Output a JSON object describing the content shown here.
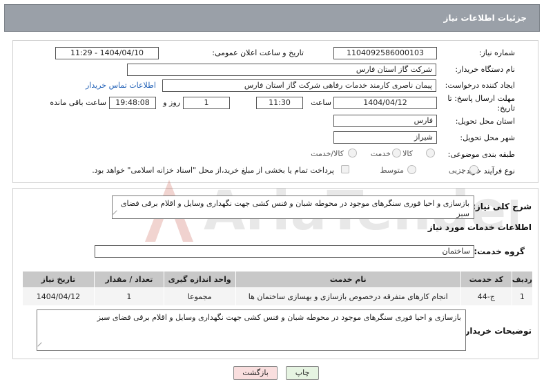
{
  "header": {
    "title": "جزئیات اطلاعات نیاز"
  },
  "form": {
    "need_number_label": "شماره نیاز:",
    "need_number": "1104092586000103",
    "announce_label": "تاریخ و ساعت اعلان عمومی:",
    "announce_value": "1404/04/10 - 11:29",
    "buyer_org_label": "نام دستگاه خریدار:",
    "buyer_org": "شرکت گاز استان فارس",
    "requester_label": "ایجاد کننده درخواست:",
    "requester": "پیمان ناصری کارمند خدمات رفاهی شرکت گاز استان فارس",
    "contact_link": "اطلاعات تماس خریدار",
    "deadline_label": "مهلت ارسال پاسخ: تا تاریخ:",
    "deadline_date": "1404/04/12",
    "time_label": "ساعت",
    "deadline_time": "11:30",
    "days_value": "1",
    "days_label": "روز و",
    "remaining_time": "19:48:08",
    "remaining_label": "ساعت باقی مانده",
    "province_label": "استان محل تحویل:",
    "province": "فارس",
    "city_label": "شهر محل تحویل:",
    "city": "شیراز",
    "category_label": "طبقه بندی موضوعی:",
    "category_options": [
      "کالا",
      "خدمت",
      "کالا/خدمت"
    ],
    "process_label": "نوع فرآیند خرید :",
    "process_options": [
      "جزیی",
      "متوسط"
    ],
    "payment_note": "پرداخت تمام یا بخشی از مبلغ خرید،از محل \"اسناد خزانه اسلامی\" خواهد بود."
  },
  "details": {
    "summary_label": "شرح کلی نیاز:",
    "summary": "بازسازی و احیا فوری سنگرهای موجود در محوطه شبان و فنس کشی جهت نگهداری وسایل و اقلام برقی فضای سبز",
    "services_title": "اطلاعات خدمات مورد نیاز",
    "service_group_label": "گروه خدمت:",
    "service_group": "ساختمان",
    "table": {
      "headers": [
        "ردیف",
        "کد خدمت",
        "نام خدمت",
        "واحد اندازه گیری",
        "تعداد / مقدار",
        "تاریخ نیاز"
      ],
      "rows": [
        [
          "1",
          "ج-44",
          "انجام کارهای متفرقه درخصوص بازسازی و بهسازی ساختمان ها",
          "مجموعا",
          "1",
          "1404/04/12"
        ]
      ]
    },
    "buyer_notes_label": "توضیحات خریدار:",
    "buyer_notes": "بازسازی و احیا فوری سنگرهای موجود در محوطه شبان و فنس کشی جهت نگهداری وسایل و اقلام برقی فضای سبز"
  },
  "buttons": {
    "print": "چاپ",
    "back": "بازگشت"
  },
  "colors": {
    "header_bg": "#9aa0a8",
    "link": "#1f5fb6",
    "back_btn": "#f9dede",
    "print_btn": "#e6f4e2"
  },
  "watermark": {
    "text": "AriaTender.neT"
  }
}
